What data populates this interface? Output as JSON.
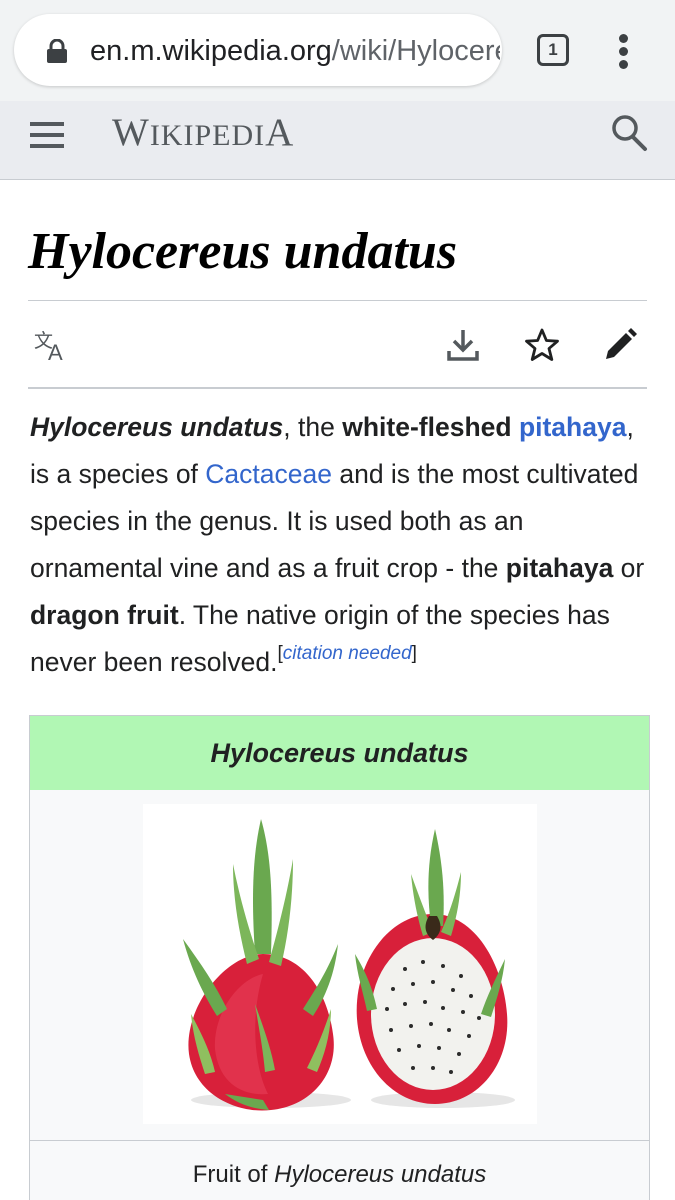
{
  "browser": {
    "url_host": "en.m.wikipedia.org",
    "url_path": "/wiki/Hylocereus_undatus",
    "tab_count": "1"
  },
  "header": {
    "wordmark_w": "W",
    "wordmark_ikipedi": "IKIPEDI",
    "wordmark_a": "A"
  },
  "page": {
    "title": "Hylocereus undatus"
  },
  "lead": {
    "subject": "Hylocereus undatus",
    "t1": ", the ",
    "bold_white": "white-fleshed",
    "t2": " ",
    "link_pitahaya": "pitahaya",
    "t3": ", is a species of ",
    "link_cactaceae": "Cactaceae",
    "t4": " and is the most cultivated species in the genus. It is used both as an ornamental vine and as a fruit crop - the ",
    "bold_pitahaya": "pitahaya",
    "t5": " or ",
    "bold_dragon": "dragon fruit",
    "t6": ". The native origin of the species has never been resolved.",
    "cite_open": "[",
    "cite_text": "citation needed",
    "cite_close": "]"
  },
  "infobox": {
    "heading": "Hylocereus undatus",
    "caption_prefix": "Fruit of ",
    "caption_italic": "Hylocereus undatus"
  },
  "colors": {
    "link": "#3366cc",
    "infobox_header": "#b1f7b4",
    "fruit_skin": "#d8203a",
    "bract_green": "#6aa84f",
    "flesh": "#f2f2ee"
  },
  "icons": [
    "lock-icon",
    "tabs-icon",
    "more-vert-icon",
    "menu-icon",
    "search-icon",
    "language-icon",
    "download-icon",
    "star-icon",
    "edit-icon"
  ]
}
